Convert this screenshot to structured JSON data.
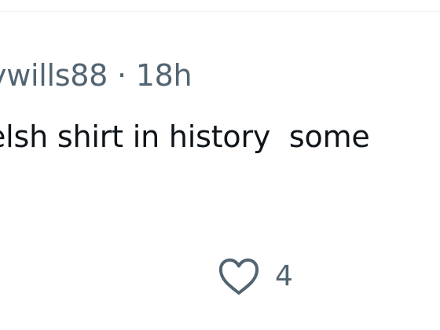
{
  "post": {
    "username": "ywills88",
    "separator": "·",
    "time_ago": "18h",
    "body_text": "elsh shirt in history  some",
    "like_count": "4"
  },
  "icons": {
    "like": "heart-outline-icon"
  },
  "colors": {
    "secondary_text": "#536471",
    "primary_text": "#0f1419",
    "divider": "#eff3f4",
    "background": "#ffffff"
  }
}
